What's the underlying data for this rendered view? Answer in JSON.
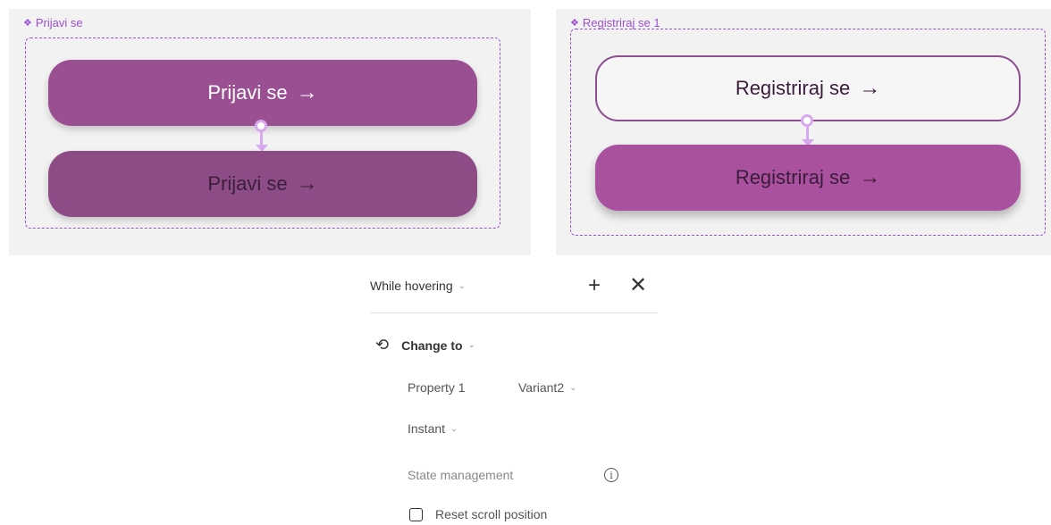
{
  "canvas": {
    "left_component": {
      "label": "Prijavi se",
      "buttons": [
        {
          "text": "Prijavi se",
          "arrow": "→"
        },
        {
          "text": "Prijavi se",
          "arrow": "→"
        }
      ]
    },
    "right_component": {
      "label": "Registriraj se 1",
      "buttons": [
        {
          "text": "Registriraj se",
          "arrow": "→"
        },
        {
          "text": "Registriraj se",
          "arrow": "→"
        }
      ]
    }
  },
  "interaction": {
    "trigger": "While hovering",
    "add_icon": "plus-icon",
    "close_icon": "close-icon",
    "action": "Change to",
    "property_label": "Property 1",
    "property_value": "Variant2",
    "animation": "Instant",
    "state_management": "State management",
    "reset_scroll": "Reset scroll position",
    "reset_scroll_checked": false
  },
  "colors": {
    "accent": "#9b4fd1",
    "login_button": "#9a4f93",
    "register_hover": "#a9519f"
  }
}
